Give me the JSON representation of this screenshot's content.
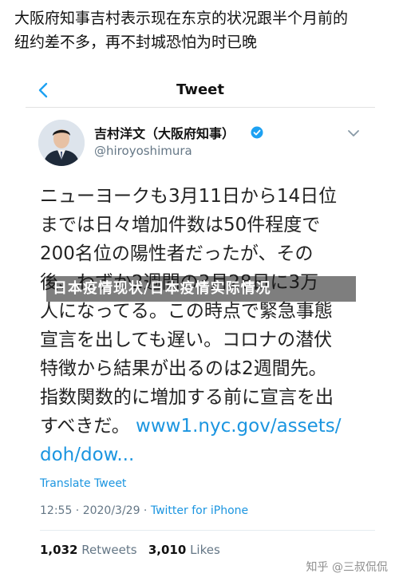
{
  "headline": {
    "line1": "大阪府知事吉村表示现在东京的状况跟半个月前的",
    "line2": "纽约差不多，再不封城恐怕为时已晚"
  },
  "tweet_header": {
    "title": "Tweet",
    "back_icon": "chevron-left-icon"
  },
  "author": {
    "name": "吉村洋文（大阪府知事）",
    "handle": "@hiroyoshimura",
    "verified_icon": "verified-badge-icon",
    "menu_icon": "chevron-down-icon"
  },
  "tweet": {
    "lines": [
      "ニューヨークも3月11日から14日位",
      "までは日々増加件数は50件程度で",
      "200名位の陽性者だったが、その",
      "後、わずか2週間の3月28日に3万",
      "人になってる。この時点で緊急事態",
      "宣言を出しても遅い。コロナの潜伏",
      "特徴から結果が出るのは2週間先。",
      "指数関数的に増加する前に宣言を出"
    ],
    "line9_text": "すべきだ。",
    "link_part1": "www1.nyc.gov/assets/",
    "link_part2": "doh/dow..."
  },
  "overlay": {
    "text": "日本疫情现状/日本疫情实际情况"
  },
  "translate_label": "Translate Tweet",
  "meta": {
    "datetime": "12:55 · 2020/3/29 · ",
    "source": "Twitter for iPhone"
  },
  "stats": {
    "retweets_count": "1,032",
    "retweets_label": "Retweets",
    "likes_count": "3,010",
    "likes_label": "Likes"
  },
  "watermark": "知乎 @三叔侃侃",
  "colors": {
    "link": "#1b95e0",
    "meta": "#657786",
    "verified": "#1da1f2"
  }
}
